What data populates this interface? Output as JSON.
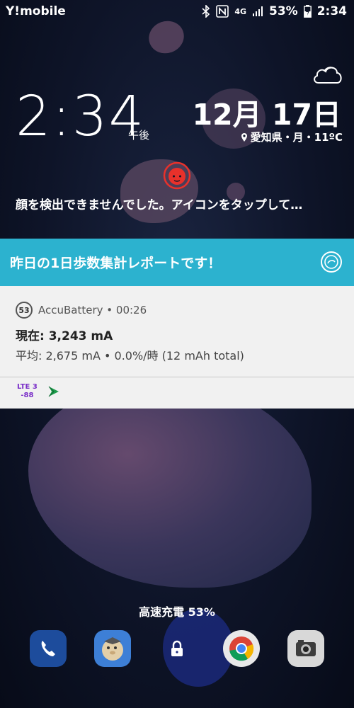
{
  "status_bar": {
    "carrier": "Y!mobile",
    "network": "4G",
    "battery_percent": "53%",
    "time": "2:34"
  },
  "lockscreen": {
    "clock": "2:34",
    "ampm": "午後",
    "date": "12月 17日",
    "location_weather": "愛知県・月・11ºC",
    "face_message": "顔を検出できませんでした。アイコンをタップして…"
  },
  "banner": {
    "text": "昨日の1日歩数集計レポートです！"
  },
  "notification": {
    "badge": "53",
    "app_line": "AccuBattery • 00:26",
    "line1": "現在: 3,243 mA",
    "line2": "平均: 2,675 mA • 0.0%/時 (12 mAh total)",
    "lte_line1": "LTE 3",
    "lte_line2": "-88"
  },
  "charging": {
    "text": "高速充電 53%"
  },
  "colors": {
    "banner_bg": "#2cb2cf",
    "face_icon": "#e8312b",
    "lte_text": "#7a2ec8",
    "play_icon": "#1e9c4c"
  }
}
